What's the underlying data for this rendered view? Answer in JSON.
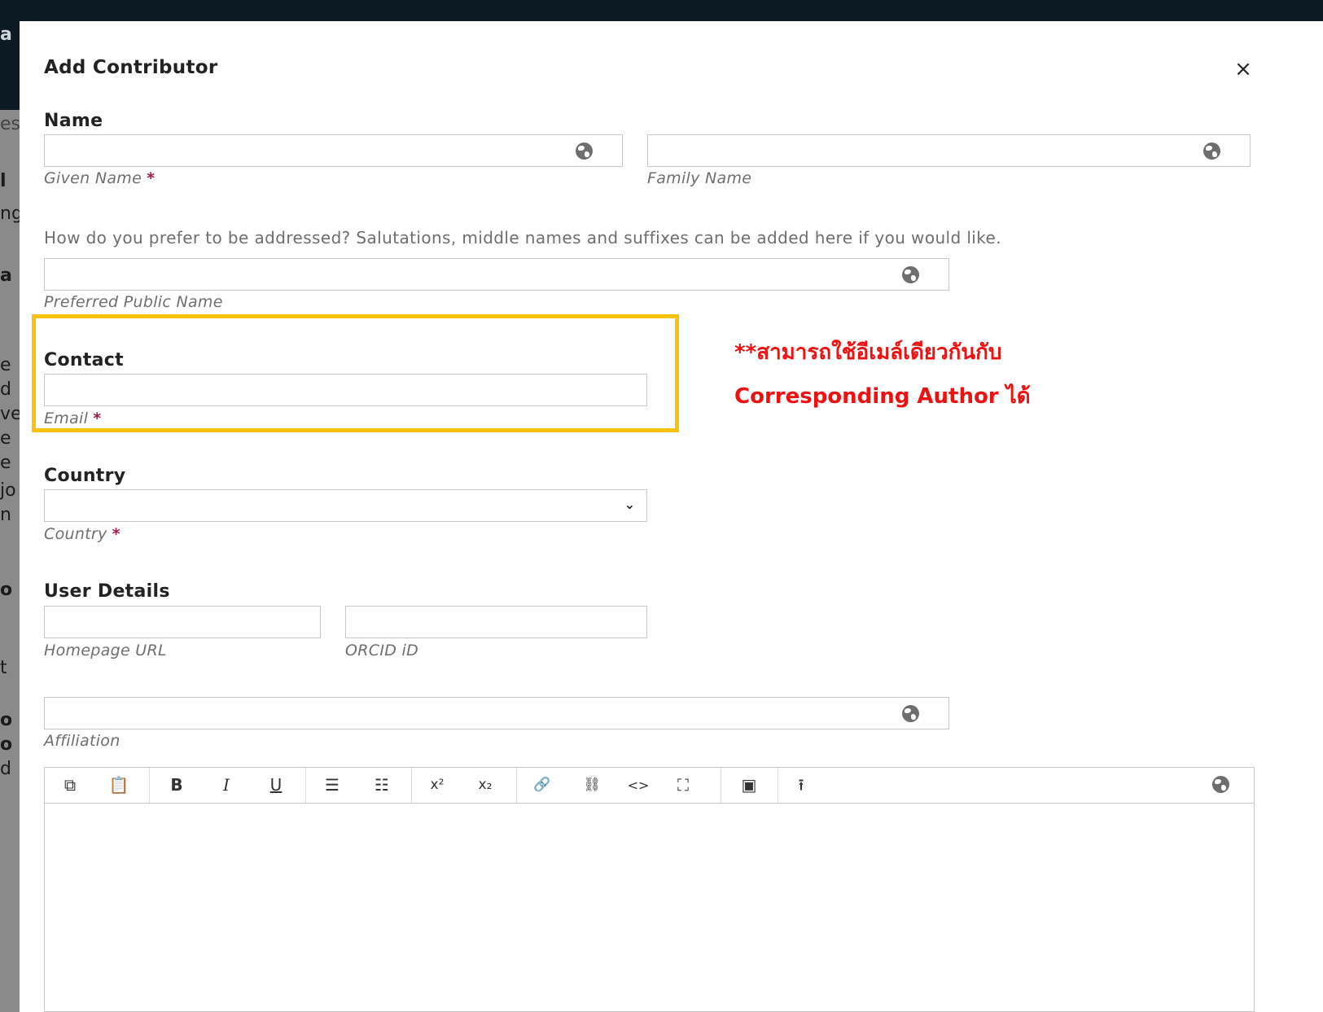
{
  "modal": {
    "title": "Add Contributor",
    "close_icon": "close-icon"
  },
  "name_section": {
    "heading": "Name",
    "given_name": {
      "value": "",
      "label": "Given Name",
      "required": "*"
    },
    "family_name": {
      "value": "",
      "label": "Family Name"
    },
    "help_text": "How do you prefer to be addressed? Salutations, middle names and suffixes can be added here if you would like.",
    "preferred_public_name": {
      "value": "",
      "label": "Preferred Public Name"
    }
  },
  "contact_section": {
    "heading": "Contact",
    "email": {
      "value": "",
      "label": "Email",
      "required": "*"
    }
  },
  "annotation": {
    "line1": "**สามารถใช้อีเมล์เดียวกันกับ",
    "line2": "Corresponding Author ได้",
    "color": "#ee1111",
    "highlight_color": "#fbc10b"
  },
  "country_section": {
    "heading": "Country",
    "selected": "",
    "label": "Country",
    "required": "*"
  },
  "user_details": {
    "heading": "User Details",
    "homepage": {
      "value": "",
      "label": "Homepage URL"
    },
    "orcid": {
      "value": "",
      "label": "ORCID iD"
    },
    "affiliation": {
      "value": "",
      "label": "Affiliation"
    }
  },
  "editor": {
    "toolbar": [
      {
        "name": "copy-icon",
        "glyph": "⧉"
      },
      {
        "name": "paste-icon",
        "glyph": "📋"
      },
      {
        "name": "bold-icon",
        "glyph": "B"
      },
      {
        "name": "italic-icon",
        "glyph": "I"
      },
      {
        "name": "underline-icon",
        "glyph": "U"
      },
      {
        "name": "bullet-list-icon",
        "glyph": "☰"
      },
      {
        "name": "numbered-list-icon",
        "glyph": "☷"
      },
      {
        "name": "superscript-icon",
        "glyph": "x²"
      },
      {
        "name": "subscript-icon",
        "glyph": "x₂"
      },
      {
        "name": "link-icon",
        "glyph": "🔗"
      },
      {
        "name": "unlink-icon",
        "glyph": "⛓"
      },
      {
        "name": "code-icon",
        "glyph": "<>"
      },
      {
        "name": "fullscreen-icon",
        "glyph": "⛶"
      },
      {
        "name": "image-icon",
        "glyph": "▣"
      },
      {
        "name": "upload-icon",
        "glyph": "⭱"
      }
    ],
    "body": ""
  },
  "background": {
    "fragments": [
      "a",
      "es",
      "l",
      "ng",
      "a",
      "e",
      "d",
      "ve",
      "e",
      "e",
      "jo",
      "n",
      "o",
      "t",
      "o",
      "o",
      "d"
    ]
  }
}
